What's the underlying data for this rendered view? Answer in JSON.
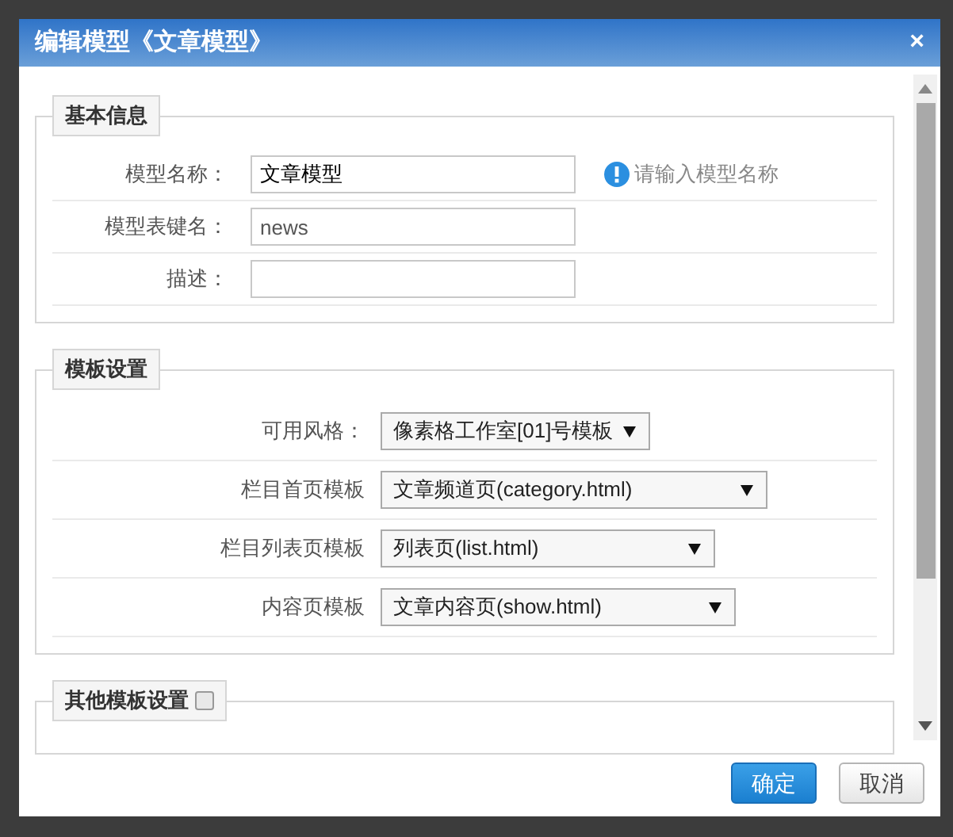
{
  "window": {
    "title": "编辑模型《文章模型》",
    "close": "×"
  },
  "sections": [
    {
      "title": "基本信息",
      "fields": [
        {
          "kind": "input",
          "label": "模型名称：",
          "value": "文章模型",
          "hint": "请输入模型名称"
        },
        {
          "kind": "input",
          "label": "模型表键名：",
          "value": "news"
        },
        {
          "kind": "input",
          "label": "描述："
        }
      ]
    },
    {
      "title": "模板设置",
      "fields": [
        {
          "kind": "select",
          "label": "可用风格：",
          "value": "像素格工作室[01]号模板"
        },
        {
          "kind": "select",
          "label": "栏目首页模板",
          "value": "文章频道页(category.html)"
        },
        {
          "kind": "select",
          "label": "栏目列表页模板",
          "value": "列表页(list.html)"
        },
        {
          "kind": "select",
          "label": "内容页模板",
          "value": "文章内容页(show.html)"
        }
      ]
    },
    {
      "title": "其他模板设置",
      "checkbox": {
        "checked": false
      }
    }
  ],
  "buttons": [
    {
      "label": "确定",
      "kind": "primary"
    },
    {
      "label": "取消",
      "kind": "secondary"
    }
  ]
}
